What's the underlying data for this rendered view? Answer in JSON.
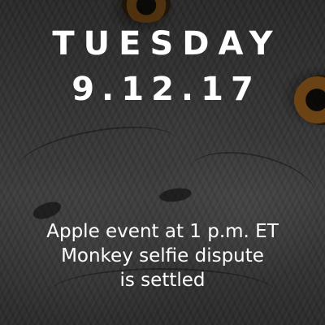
{
  "header": {
    "day": "TUESDAY",
    "date": "9.12.17"
  },
  "headlines": [
    "Apple event at 1 p.m. ET",
    "Monkey selfie dispute",
    "is settled"
  ],
  "colors": {
    "text": "#ffffff",
    "eye": "#a0611a"
  }
}
